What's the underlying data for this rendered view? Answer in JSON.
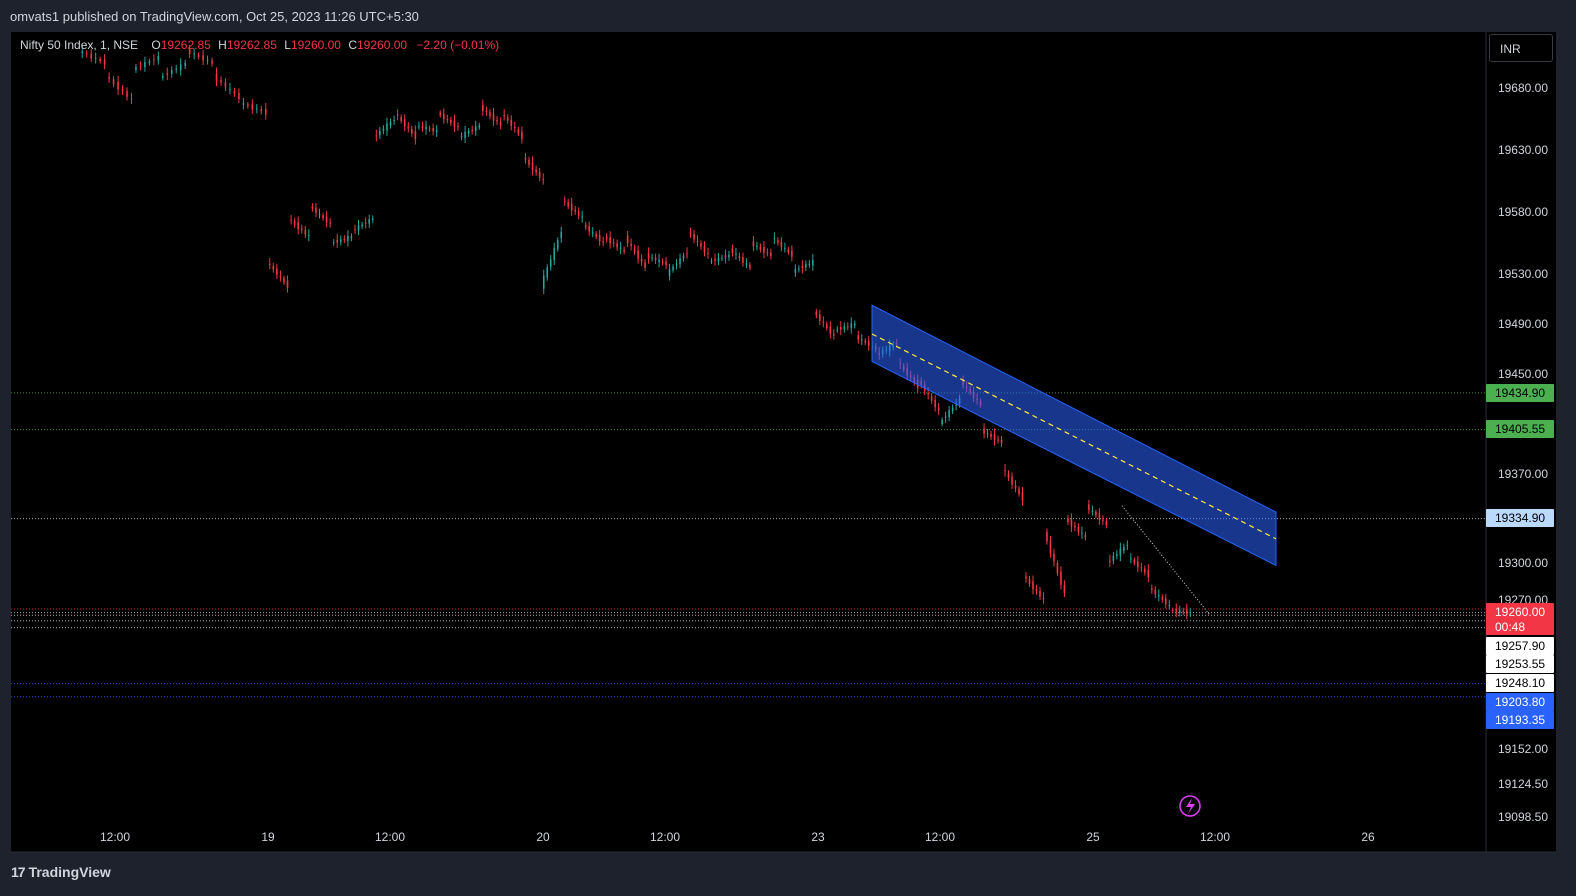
{
  "header": {
    "published": "omvats1 published on TradingView.com, Oct 25, 2023 11:26 UTC+5:30"
  },
  "legend": {
    "symbol": "Nifty 50 Index, 1, NSE",
    "o_label": "O",
    "o_value": "19262.85",
    "h_label": "H",
    "h_value": "19262.85",
    "l_label": "L",
    "l_value": "19260.00",
    "c_label": "C",
    "c_value": "19260.00",
    "change": "−2.20 (−0.01%)"
  },
  "currency": "INR",
  "footer": {
    "brand": "TradingView"
  },
  "colors": {
    "up": "#26a69a",
    "down": "#f23645",
    "channel": "#2962ff",
    "green_line": "#4caf50",
    "blue_line": "#2962ff"
  },
  "chart_data": {
    "type": "candlestick",
    "y_ticks": [
      "19680.00",
      "19630.00",
      "19580.00",
      "19530.00",
      "19490.00",
      "19450.00",
      "19370.00",
      "19300.00",
      "19270.00",
      "19152.00",
      "19124.50",
      "19098.50"
    ],
    "y_tick_values": [
      19680,
      19630,
      19580,
      19530,
      19490,
      19450,
      19370,
      19300,
      19270,
      19152,
      19124.5,
      19098.5
    ],
    "x_ticks": [
      "12:00",
      "19",
      "12:00",
      "20",
      "12:00",
      "23",
      "12:00",
      "25",
      "12:00",
      "26"
    ],
    "price_labels": [
      {
        "text": "19434.90",
        "price": 19434.9,
        "style": "green"
      },
      {
        "text": "19405.55",
        "price": 19405.55,
        "style": "green"
      },
      {
        "text": "19334.90",
        "price": 19334.9,
        "style": "light"
      },
      {
        "text": "19260.00",
        "price": 19260.0,
        "style": "red",
        "sub": "00:48"
      },
      {
        "text": "19257.90",
        "price": 19257.9,
        "style": "white"
      },
      {
        "text": "19253.55",
        "price": 19253.55,
        "style": "white"
      },
      {
        "text": "19248.10",
        "price": 19248.1,
        "style": "white"
      },
      {
        "text": "19203.80",
        "price": 19203.8,
        "style": "blue"
      },
      {
        "text": "19193.35",
        "price": 19193.35,
        "style": "blue"
      }
    ],
    "horizontal_levels": [
      {
        "price": 19434.9,
        "color": "green"
      },
      {
        "price": 19405.55,
        "color": "green"
      },
      {
        "price": 19334.9,
        "color": "white"
      },
      {
        "price": 19262.85,
        "color": "red"
      },
      {
        "price": 19260.0,
        "color": "white"
      },
      {
        "price": 19257.9,
        "color": "white"
      },
      {
        "price": 19253.55,
        "color": "white"
      },
      {
        "price": 19248.1,
        "color": "white"
      },
      {
        "price": 19203.8,
        "color": "blue"
      },
      {
        "price": 19193.35,
        "color": "blue"
      }
    ],
    "price_path": [
      [
        19710,
        19700
      ],
      [
        19690,
        19670
      ],
      [
        19695,
        19705
      ],
      [
        19688,
        19700
      ],
      [
        19710,
        19700
      ],
      [
        19690,
        19672
      ],
      [
        19668,
        19660
      ],
      [
        null,
        null
      ],
      [
        19540,
        19520
      ],
      [
        19575,
        19560
      ],
      [
        19585,
        19570
      ],
      [
        19555,
        19560
      ],
      [
        19565,
        19575
      ],
      [
        19640,
        19655
      ],
      [
        19660,
        19640
      ],
      [
        19650,
        19645
      ],
      [
        19660,
        19648
      ],
      [
        19640,
        19650
      ],
      [
        19665,
        19650
      ],
      [
        19660,
        19640
      ],
      [
        19625,
        19605
      ],
      [
        null,
        null
      ],
      [
        19520,
        19565
      ],
      [
        19590,
        19575
      ],
      [
        19570,
        19555
      ],
      [
        19560,
        19548
      ],
      [
        19560,
        19535
      ],
      [
        19545,
        19538
      ],
      [
        19530,
        19548
      ],
      [
        19565,
        19545
      ],
      [
        19540,
        19545
      ],
      [
        19550,
        19535
      ],
      [
        19555,
        19545
      ],
      [
        19560,
        19545
      ],
      [
        19532,
        19540
      ],
      [
        19500,
        19480
      ],
      [
        19485,
        19490
      ],
      [
        19480,
        19470
      ],
      [
        19465,
        19475
      ],
      [
        19460,
        19440
      ],
      [
        19445,
        19420
      ],
      [
        19410,
        19430
      ],
      [
        19445,
        19425
      ],
      [
        19405,
        19395
      ],
      [
        19375,
        19350
      ],
      [
        19290,
        19270
      ],
      [
        19325,
        19275
      ],
      [
        19335,
        19320
      ],
      [
        19345,
        19330
      ],
      [
        19300,
        19315
      ],
      [
        19305,
        19290
      ],
      [
        19280,
        19265
      ],
      [
        19262,
        19260
      ]
    ],
    "channel": {
      "upper_start": 19505,
      "upper_end": 19340,
      "lower_start": 19460,
      "lower_end": 19298,
      "mid_start": 19482,
      "mid_end": 19319,
      "x_start": "23 (09:15)",
      "x_end": "25 (15:00)"
    },
    "trendline": {
      "from": 19345,
      "to": 19258
    },
    "grid": false
  }
}
